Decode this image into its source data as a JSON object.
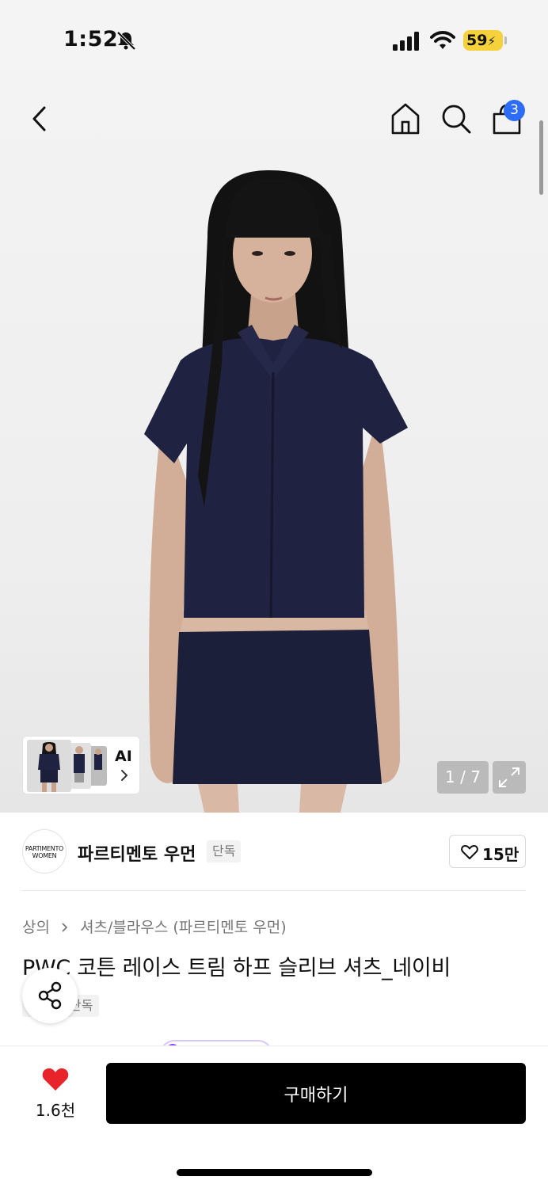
{
  "status_bar": {
    "time": "1:52",
    "battery": "59"
  },
  "header": {
    "cart_count": "3"
  },
  "gallery": {
    "ai_label": "AI",
    "counter": "1 / 7"
  },
  "brand": {
    "logo_text_1": "PARTIMENTO",
    "logo_text_2": "WOMEN",
    "name": "파르티멘토 우먼",
    "tag": "단독",
    "likes": "15만"
  },
  "product": {
    "breadcrumb": [
      "상의",
      "셔츠/블라우스 (파르티멘토 우먼)"
    ],
    "title": "PWC 코튼 레이스 트림 하프 슬리브 셔츠_네이비",
    "tag": "단독"
  },
  "bottom_bar": {
    "wish_count": "1.6천",
    "buy_label": "구매하기"
  },
  "colors": {
    "accent_blue": "#2d6df6",
    "heart_red": "#e8242b",
    "button_black": "#000000",
    "battery_yellow": "#f5d13c"
  }
}
